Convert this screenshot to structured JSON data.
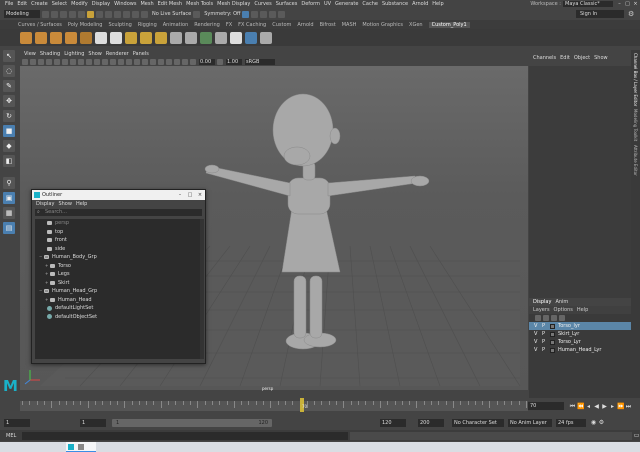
{
  "menubar": {
    "items": [
      "File",
      "Edit",
      "Create",
      "Select",
      "Modify",
      "Display",
      "Windows",
      "Mesh",
      "Edit Mesh",
      "Mesh Tools",
      "Mesh Display",
      "Curves",
      "Surfaces",
      "Deform",
      "UV",
      "Generate",
      "Cache",
      "Substance",
      "Arnold",
      "Help"
    ],
    "workspace_label": "Workspace :",
    "workspace_value": "Maya Classic*",
    "window_controls": [
      "–",
      "□",
      "×"
    ]
  },
  "statusline": {
    "mode": "Modeling",
    "live_surface": "No Live Surface",
    "symmetry": "Symmetry: Off",
    "sign_in": "Sign In"
  },
  "shelf": {
    "tabs": [
      "Curves / Surfaces",
      "Poly Modeling",
      "Sculpting",
      "Rigging",
      "Animation",
      "Rendering",
      "FX",
      "FX Caching",
      "Custom",
      "Arnold",
      "Bifrost",
      "MASH",
      "Motion Graphics",
      "XGen",
      "Custom_Poly1"
    ],
    "active_tab": "Custom_Poly1"
  },
  "viewport": {
    "menu": [
      "View",
      "Shading",
      "Lighting",
      "Show",
      "Renderer",
      "Panels"
    ],
    "exposure": "0.00",
    "gamma": "1.00",
    "color_space": "sRGB gamma",
    "camera_label": "persp"
  },
  "outliner": {
    "title": "Outliner",
    "menu": [
      "Display",
      "Show",
      "Help"
    ],
    "search_placeholder": "Search...",
    "items": [
      {
        "label": "persp",
        "indent": 0,
        "icon": "camera"
      },
      {
        "label": "top",
        "indent": 0,
        "icon": "camera"
      },
      {
        "label": "front",
        "indent": 0,
        "icon": "camera"
      },
      {
        "label": "side",
        "indent": 0,
        "icon": "camera"
      },
      {
        "label": "Human_Body_Grp",
        "indent": 0,
        "icon": "group"
      },
      {
        "label": "Torso",
        "indent": 1,
        "icon": "mesh"
      },
      {
        "label": "Legs",
        "indent": 1,
        "icon": "mesh"
      },
      {
        "label": "Skirt",
        "indent": 1,
        "icon": "mesh"
      },
      {
        "label": "Human_Head_Grp",
        "indent": 0,
        "icon": "group"
      },
      {
        "label": "Human_Head",
        "indent": 1,
        "icon": "mesh"
      },
      {
        "label": "defaultLightSet",
        "indent": 0,
        "icon": "set"
      },
      {
        "label": "defaultObjectSet",
        "indent": 0,
        "icon": "set"
      }
    ]
  },
  "channelbox": {
    "menu": [
      "Channels",
      "Edit",
      "Object",
      "Show"
    ],
    "side_tabs": [
      "Channel Box / Layer Editor",
      "Modeling Toolkit",
      "Attribute Editor"
    ]
  },
  "layers": {
    "tabs": [
      "Display",
      "Anim"
    ],
    "menu": [
      "Layers",
      "Options",
      "Help"
    ],
    "rows": [
      {
        "v": "V",
        "p": "P",
        "name": "Torso_lyr",
        "selected": true
      },
      {
        "v": "V",
        "p": "P",
        "name": "Skirt_Lyr",
        "selected": false
      },
      {
        "v": "V",
        "p": "P",
        "name": "Torso_Lyr",
        "selected": false
      },
      {
        "v": "V",
        "p": "P",
        "name": "Human_Head_Lyr",
        "selected": false
      }
    ]
  },
  "timeline": {
    "tick_labels": [
      "5",
      "10",
      "15",
      "20",
      "25",
      "30",
      "35",
      "40",
      "45",
      "50",
      "55",
      "60",
      "65",
      "70"
    ],
    "current_frame": "70",
    "end_field": "70"
  },
  "range": {
    "start": "1",
    "start_inner": "1",
    "range_start": "1",
    "range_end": "120",
    "anim_end": "120",
    "anim_end2": "200",
    "character_set": "No Character Set",
    "anim_layer": "No Anim Layer",
    "fps": "24 fps"
  },
  "cmdline": {
    "label": "MEL"
  }
}
